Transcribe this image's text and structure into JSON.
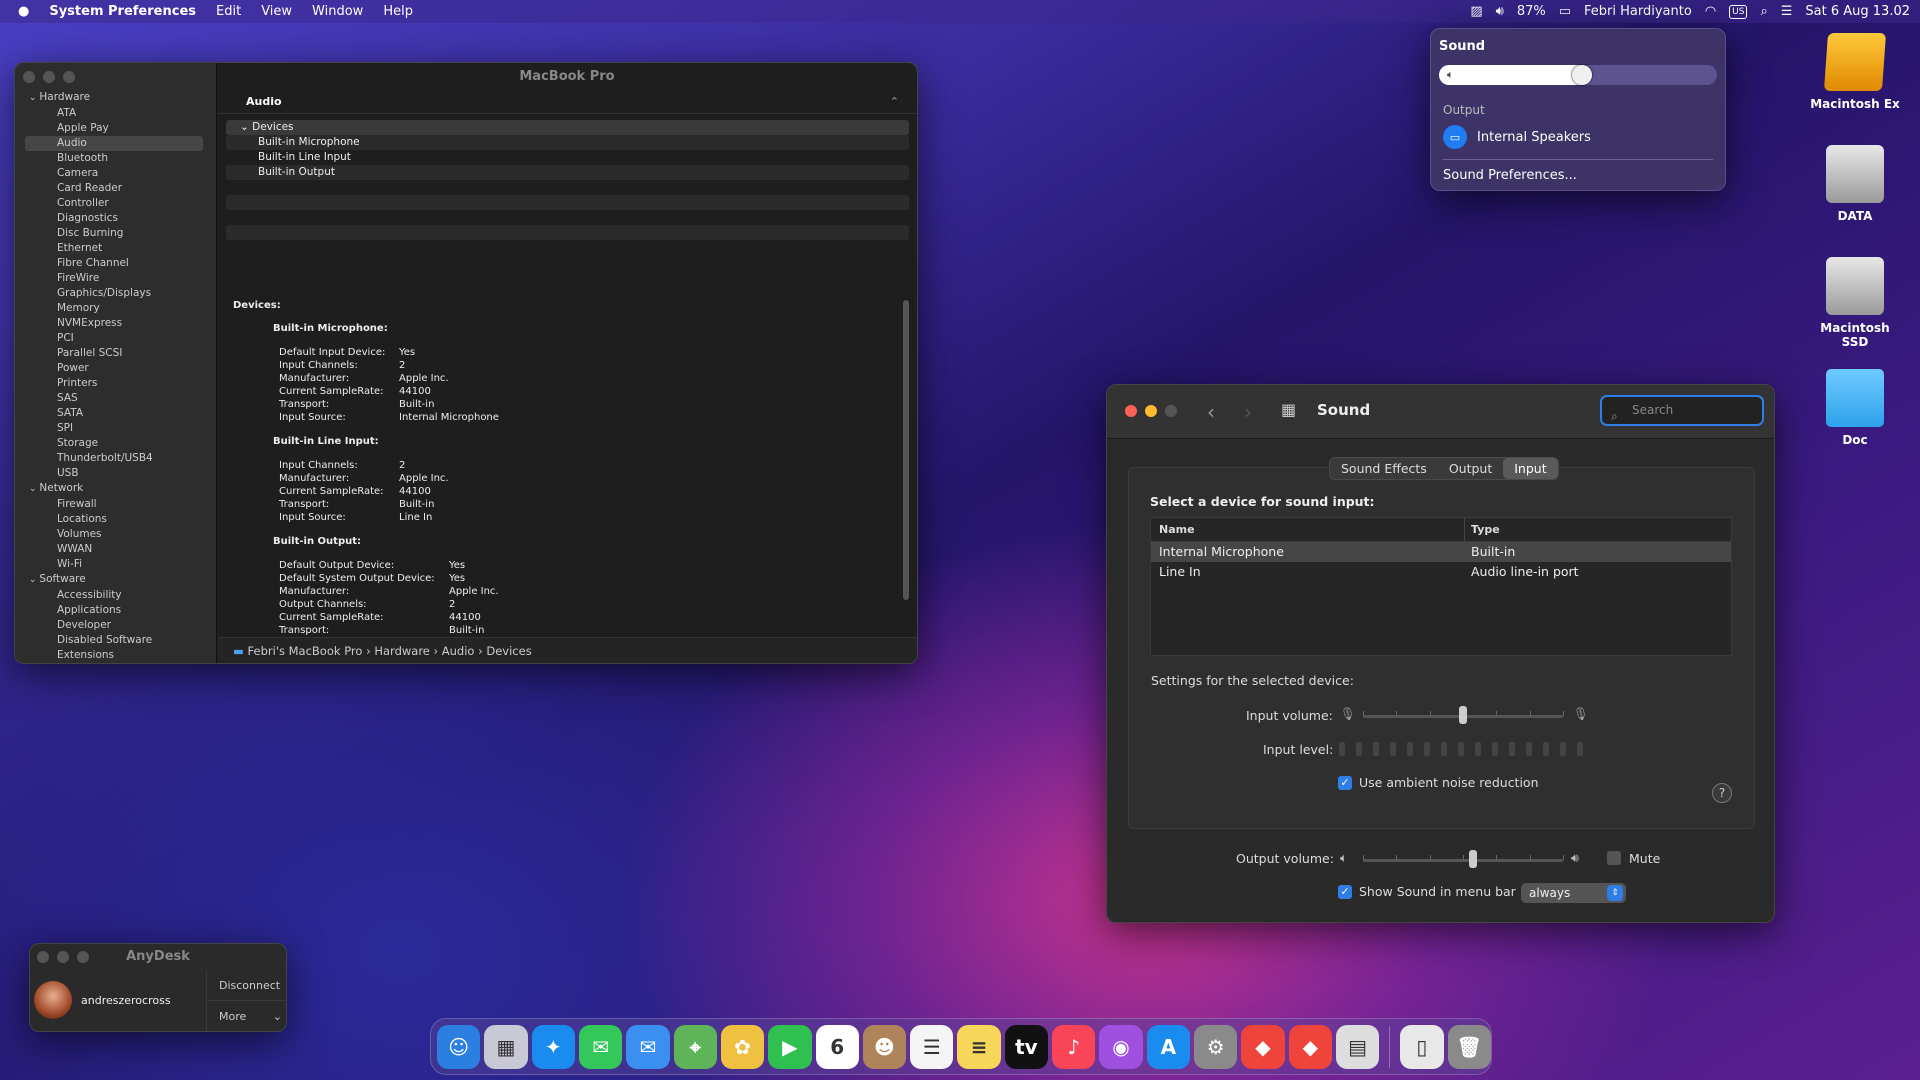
{
  "menubar": {
    "apple": "",
    "app": "System Preferences",
    "menus": [
      "Edit",
      "View",
      "Window",
      "Help"
    ],
    "battery": "87%",
    "user": "Febri Hardiyanto",
    "input_source": "US",
    "datetime": "Sat 6 Aug  13.02"
  },
  "sysinfo": {
    "window_title": "MacBook Pro",
    "tree": [
      {
        "type": "cat",
        "label": "Hardware"
      },
      {
        "type": "item",
        "label": "ATA"
      },
      {
        "type": "item",
        "label": "Apple Pay"
      },
      {
        "type": "item",
        "label": "Audio",
        "selected": true
      },
      {
        "type": "item",
        "label": "Bluetooth"
      },
      {
        "type": "item",
        "label": "Camera"
      },
      {
        "type": "item",
        "label": "Card Reader"
      },
      {
        "type": "item",
        "label": "Controller"
      },
      {
        "type": "item",
        "label": "Diagnostics"
      },
      {
        "type": "item",
        "label": "Disc Burning"
      },
      {
        "type": "item",
        "label": "Ethernet"
      },
      {
        "type": "item",
        "label": "Fibre Channel"
      },
      {
        "type": "item",
        "label": "FireWire"
      },
      {
        "type": "item",
        "label": "Graphics/Displays"
      },
      {
        "type": "item",
        "label": "Memory"
      },
      {
        "type": "item",
        "label": "NVMExpress"
      },
      {
        "type": "item",
        "label": "PCI"
      },
      {
        "type": "item",
        "label": "Parallel SCSI"
      },
      {
        "type": "item",
        "label": "Power"
      },
      {
        "type": "item",
        "label": "Printers"
      },
      {
        "type": "item",
        "label": "SAS"
      },
      {
        "type": "item",
        "label": "SATA"
      },
      {
        "type": "item",
        "label": "SPI"
      },
      {
        "type": "item",
        "label": "Storage"
      },
      {
        "type": "item",
        "label": "Thunderbolt/USB4"
      },
      {
        "type": "item",
        "label": "USB"
      },
      {
        "type": "cat",
        "label": "Network"
      },
      {
        "type": "item",
        "label": "Firewall"
      },
      {
        "type": "item",
        "label": "Locations"
      },
      {
        "type": "item",
        "label": "Volumes"
      },
      {
        "type": "item",
        "label": "WWAN"
      },
      {
        "type": "item",
        "label": "Wi-Fi"
      },
      {
        "type": "cat",
        "label": "Software"
      },
      {
        "type": "item",
        "label": "Accessibility"
      },
      {
        "type": "item",
        "label": "Applications"
      },
      {
        "type": "item",
        "label": "Developer"
      },
      {
        "type": "item",
        "label": "Disabled Software"
      },
      {
        "type": "item",
        "label": "Extensions"
      }
    ],
    "section_header": "Audio",
    "list": {
      "group": "Devices",
      "rows": [
        "Built-in Microphone",
        "Built-in Line Input",
        "Built-in Output"
      ]
    },
    "detail": {
      "heading": "Devices:",
      "devices": [
        {
          "name": "Built-in Microphone:",
          "wide": false,
          "props": [
            [
              "Default Input Device:",
              "Yes"
            ],
            [
              "Input Channels:",
              "2"
            ],
            [
              "Manufacturer:",
              "Apple Inc."
            ],
            [
              "Current SampleRate:",
              "44100"
            ],
            [
              "Transport:",
              "Built-in"
            ],
            [
              "Input Source:",
              "Internal Microphone"
            ]
          ]
        },
        {
          "name": "Built-in Line Input:",
          "wide": false,
          "props": [
            [
              "Input Channels:",
              "2"
            ],
            [
              "Manufacturer:",
              "Apple Inc."
            ],
            [
              "Current SampleRate:",
              "44100"
            ],
            [
              "Transport:",
              "Built-in"
            ],
            [
              "Input Source:",
              "Line In"
            ]
          ]
        },
        {
          "name": "Built-in Output:",
          "wide": true,
          "props": [
            [
              "Default Output Device:",
              "Yes"
            ],
            [
              "Default System Output Device:",
              "Yes"
            ],
            [
              "Manufacturer:",
              "Apple Inc."
            ],
            [
              "Output Channels:",
              "2"
            ],
            [
              "Current SampleRate:",
              "44100"
            ],
            [
              "Transport:",
              "Built-in"
            ]
          ]
        }
      ]
    },
    "path": "Febri's MacBook Pro  ›  Hardware  ›  Audio  ›  Devices"
  },
  "sound_popover": {
    "title": "Sound",
    "volume": 0.55,
    "output_header": "Output",
    "device": "Internal Speakers",
    "prefs_link": "Sound Preferences..."
  },
  "sound_prefs": {
    "title": "Sound",
    "search_placeholder": "Search",
    "tabs": [
      {
        "label": "Sound Effects",
        "active": false
      },
      {
        "label": "Output",
        "active": false
      },
      {
        "label": "Input",
        "active": true
      }
    ],
    "select_label": "Select a device for sound input:",
    "columns": [
      "Name",
      "Type"
    ],
    "devices": [
      {
        "name": "Internal Microphone",
        "type": "Built-in",
        "selected": true
      },
      {
        "name": "Line In",
        "type": "Audio line-in port",
        "selected": false
      }
    ],
    "settings_label": "Settings for the selected device:",
    "input_volume_label": "Input volume:",
    "input_volume": 0.5,
    "input_level_label": "Input level:",
    "noise_reduction_label": "Use ambient noise reduction",
    "noise_reduction_checked": true,
    "help": "?",
    "output_volume_label": "Output volume:",
    "output_volume": 0.55,
    "mute_label": "Mute",
    "mute_checked": false,
    "show_in_menu_label": "Show Sound in menu bar",
    "show_in_menu_checked": true,
    "show_in_menu_value": "always"
  },
  "desktop": {
    "icons": [
      {
        "label": "Macintosh Ex",
        "kind": "drive-orange"
      },
      {
        "label": "DATA",
        "kind": "drive-gray"
      },
      {
        "label": "Macintosh SSD",
        "kind": "drive-gray"
      },
      {
        "label": "Doc",
        "kind": "folder"
      }
    ]
  },
  "anydesk": {
    "title": "AnyDesk",
    "user": "andreszerocross",
    "disconnect": "Disconnect",
    "more": "More"
  },
  "dock": {
    "apps": [
      {
        "name": "finder",
        "color": "#2a7fe0",
        "glyph": "☺"
      },
      {
        "name": "launchpad",
        "color": "#c9c9d6",
        "glyph": "▦"
      },
      {
        "name": "safari",
        "color": "#1a8cf0",
        "glyph": "✦"
      },
      {
        "name": "messages",
        "color": "#34c759",
        "glyph": "✉"
      },
      {
        "name": "mail",
        "color": "#3a8ff0",
        "glyph": "✉"
      },
      {
        "name": "maps",
        "color": "#5fb45a",
        "glyph": "⌖"
      },
      {
        "name": "photos",
        "color": "#f0c040",
        "glyph": "✿"
      },
      {
        "name": "facetime",
        "color": "#30c050",
        "glyph": "▶"
      },
      {
        "name": "calendar",
        "color": "#ffffff",
        "glyph": "6"
      },
      {
        "name": "contacts",
        "color": "#b0845a",
        "glyph": "☻"
      },
      {
        "name": "reminders",
        "color": "#f5f5f5",
        "glyph": "☰"
      },
      {
        "name": "notes",
        "color": "#f6d75a",
        "glyph": "≡"
      },
      {
        "name": "tv",
        "color": "#111111",
        "glyph": "tv"
      },
      {
        "name": "music",
        "color": "#fa4559",
        "glyph": "♪"
      },
      {
        "name": "podcasts",
        "color": "#a050e0",
        "glyph": "◉"
      },
      {
        "name": "app-store",
        "color": "#1a8cf0",
        "glyph": "A"
      },
      {
        "name": "system-preferences",
        "color": "#8a8a8a",
        "glyph": "⚙"
      },
      {
        "name": "anydesk",
        "color": "#ef443b",
        "glyph": "◆"
      },
      {
        "name": "anydesk-2",
        "color": "#ef443b",
        "glyph": "◆"
      },
      {
        "name": "preview",
        "color": "#dddddd",
        "glyph": "▤"
      }
    ],
    "trash": [
      {
        "name": "document",
        "color": "#e8e8e8",
        "glyph": "▯"
      },
      {
        "name": "trash",
        "color": "#8a8a8a",
        "glyph": "🗑"
      }
    ]
  }
}
